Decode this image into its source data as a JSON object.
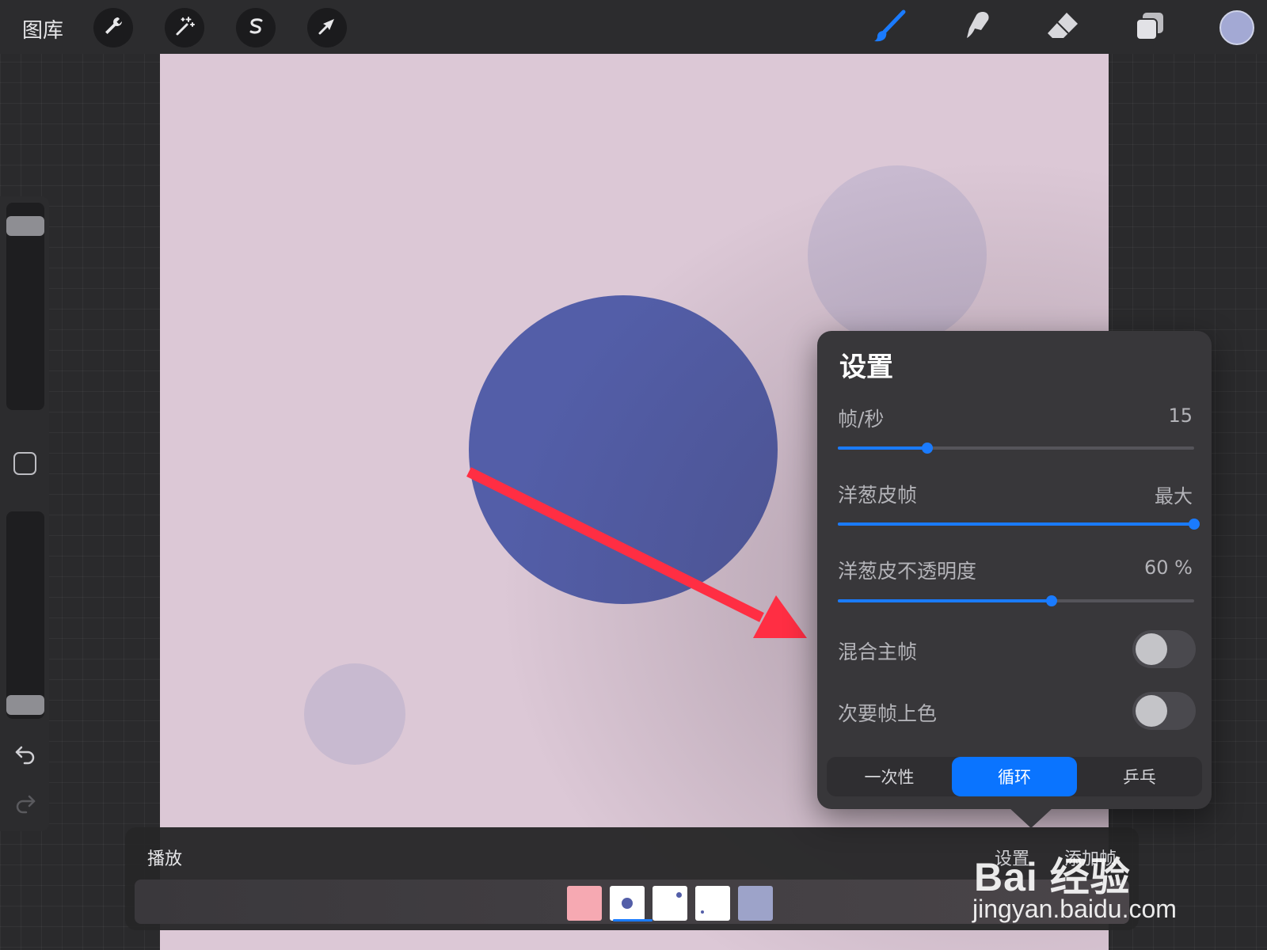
{
  "toolbar": {
    "gallery_label": "图库",
    "left_tools": [
      "wrench-icon",
      "magic-wand-icon",
      "selection-s-icon",
      "transform-arrow-icon"
    ],
    "right_tools": [
      "brush-icon",
      "smudge-icon",
      "eraser-icon",
      "layers-icon"
    ],
    "current_color": "#a3a9d4",
    "active_tool_color": "#1a7bff"
  },
  "canvas": {
    "background": "#dcc8d6",
    "main_circle_color": "#535ea8",
    "onion_circle_color": "#c8bad0",
    "annotation_arrow_color": "#ff2e43"
  },
  "sidebar": {
    "brush_size_level": 0.93,
    "opacity_level": 0.02,
    "icons": [
      "modify-square-icon",
      "undo-icon",
      "redo-icon"
    ]
  },
  "settings": {
    "title": "设置",
    "fps": {
      "label": "帧/秒",
      "value": "15",
      "level": 0.25
    },
    "onion_frames": {
      "label": "洋葱皮帧",
      "value": "最大",
      "level": 1.0
    },
    "onion_opacity": {
      "label": "洋葱皮不透明度",
      "value": "60 %",
      "level": 0.6
    },
    "blend_primary": {
      "label": "混合主帧",
      "on": false
    },
    "color_secondary": {
      "label": "次要帧上色",
      "on": false
    },
    "modes": [
      "一次性",
      "循环",
      "乒乓"
    ],
    "active_mode": "循环"
  },
  "timeline": {
    "play_label": "播放",
    "settings_label": "设置",
    "add_frame_label": "添加帧",
    "frames": [
      {
        "bg": "#f6a9b2"
      },
      {
        "bg": "#ffffff"
      },
      {
        "bg": "#ffffff"
      },
      {
        "bg": "#ffffff"
      },
      {
        "bg": "#9da3c9"
      }
    ]
  },
  "watermark": {
    "brand": "Bai 经验",
    "url": "jingyan.baidu.com"
  }
}
